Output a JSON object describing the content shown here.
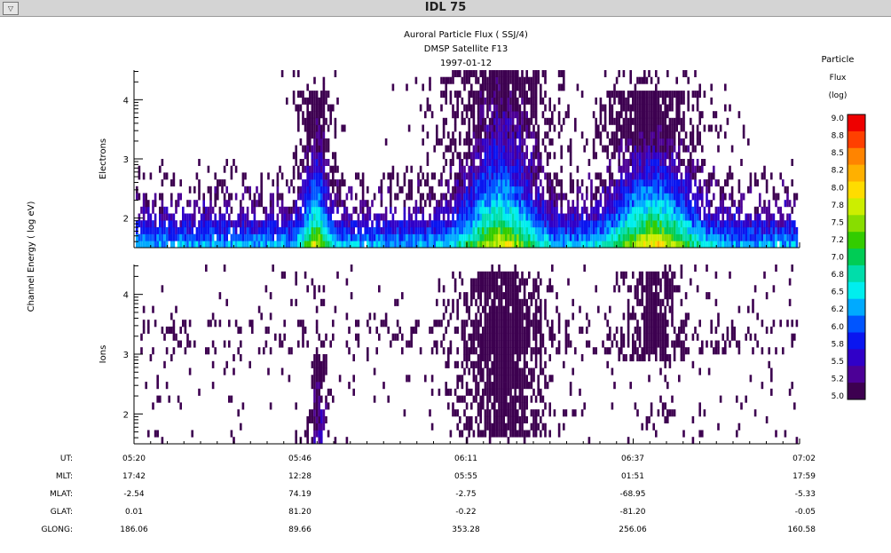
{
  "window": {
    "title": "IDL 75",
    "menu_glyph": "▽"
  },
  "chart_data": {
    "type": "heatmap",
    "title": "Auroral Particle Flux ( SSJ/4)",
    "subtitle": "DMSP Satellite F13",
    "date": "1997-01-12",
    "ylabel": "Channel Energy ( log eV)",
    "ylim": [
      1.5,
      4.5
    ],
    "panels": [
      {
        "name": "Electrons",
        "yticks": [
          "2",
          "3",
          "4"
        ]
      },
      {
        "name": "Ions",
        "yticks": [
          "2",
          "3",
          "4"
        ]
      }
    ],
    "colorbar": {
      "title": [
        "Particle",
        "Flux",
        "(log)"
      ],
      "labels": [
        "9.0",
        "8.8",
        "8.5",
        "8.2",
        "8.0",
        "7.8",
        "7.5",
        "7.2",
        "7.0",
        "6.8",
        "6.5",
        "6.2",
        "6.0",
        "5.8",
        "5.5",
        "5.2",
        "5.0"
      ],
      "colors": [
        "#ee0000",
        "#ff4000",
        "#ff8400",
        "#ffb000",
        "#ffdc00",
        "#ccee00",
        "#88dd00",
        "#33cc00",
        "#00cc55",
        "#00ddaa",
        "#00eeee",
        "#00aaff",
        "#0055ff",
        "#0a16f0",
        "#3000c8",
        "#4c0096",
        "#3d0050"
      ]
    },
    "x_rows": [
      {
        "label": "UT:",
        "values": [
          "05:20",
          "05:46",
          "06:11",
          "06:37",
          "07:02"
        ]
      },
      {
        "label": "MLT:",
        "values": [
          "17:42",
          "12:28",
          "05:55",
          "01:51",
          "17:59"
        ]
      },
      {
        "label": "MLAT:",
        "values": [
          "-2.54",
          "74.19",
          "-2.75",
          "-68.95",
          "-5.33"
        ]
      },
      {
        "label": "GLAT:",
        "values": [
          "0.01",
          "81.20",
          "-0.22",
          "-81.20",
          "-0.05"
        ]
      },
      {
        "label": "GLONG:",
        "values": [
          "186.06",
          "89.66",
          "353.28",
          "256.06",
          "160.58"
        ]
      }
    ]
  }
}
